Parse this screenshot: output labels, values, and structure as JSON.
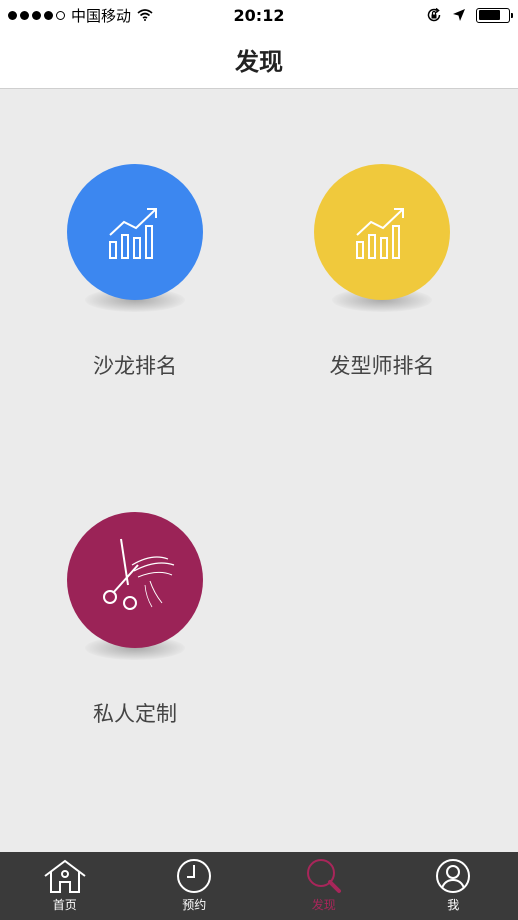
{
  "status_bar": {
    "carrier": "中国移动",
    "time": "20:12",
    "battery_level": 0.75
  },
  "nav": {
    "title": "发现"
  },
  "features": [
    {
      "id": "salon",
      "label": "沙龙排名",
      "color": "#3c87f0",
      "icon": "chart-growth-icon"
    },
    {
      "id": "stylist",
      "label": "发型师排名",
      "color": "#f0c93c",
      "icon": "chart-growth-icon"
    },
    {
      "id": "custom",
      "label": "私人定制",
      "color": "#9b2357",
      "icon": "scissors-icon"
    }
  ],
  "tabs": [
    {
      "label": "首页",
      "icon": "home-icon"
    },
    {
      "label": "预约",
      "icon": "clock-icon"
    },
    {
      "label": "发现",
      "icon": "search-icon",
      "active": true
    },
    {
      "label": "我",
      "icon": "user-icon"
    }
  ],
  "colors": {
    "active_tab": "#a8265a",
    "tab_bar_bg": "#3a3a3a",
    "page_bg": "#ebebeb"
  }
}
